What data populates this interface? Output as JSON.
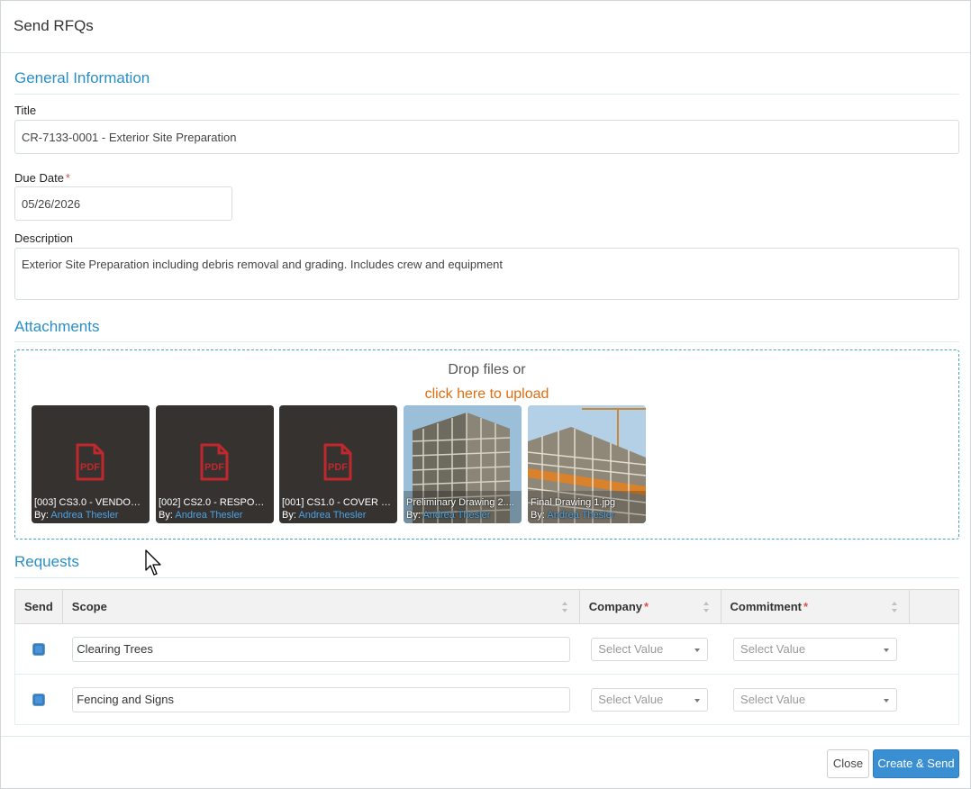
{
  "modal": {
    "title": "Send RFQs"
  },
  "general": {
    "heading": "General Information",
    "title_label": "Title",
    "title_value": "CR-7133-0001 - Exterior Site Preparation",
    "due_label": "Due Date",
    "required_mark": "*",
    "due_value": "05/26/2026",
    "description_label": "Description",
    "description_value": "Exterior Site Preparation including debris removal and grading. Includes crew and equipment"
  },
  "attachments": {
    "heading": "Attachments",
    "drop_text": "Drop files or",
    "upload_link": "click here to upload",
    "by_prefix": "By:",
    "pdf_label": "PDF",
    "files": [
      {
        "name": "[003] CS3.0 - VENDOR...",
        "author": "Andrea Thesler",
        "kind": "pdf"
      },
      {
        "name": "[002] CS2.0 - RESPONS...",
        "author": "Andrea Thesler",
        "kind": "pdf"
      },
      {
        "name": "[001] CS1.0 - COVER SH...",
        "author": "Andrea Thesler",
        "kind": "pdf"
      },
      {
        "name": "Preliminary Drawing 2....",
        "author": "Andrea Thesler",
        "kind": "image"
      },
      {
        "name": "Final Drawing 1.jpg",
        "author": "Andrea Thesler",
        "kind": "image"
      }
    ]
  },
  "requests": {
    "heading": "Requests",
    "columns": {
      "send": "Send",
      "scope": "Scope",
      "company": "Company",
      "commitment": "Commitment"
    },
    "rows": [
      {
        "checked": true,
        "scope": "Clearing Trees",
        "company": "Select Value",
        "commitment": "Select Value"
      },
      {
        "checked": true,
        "scope": "Fencing and Signs",
        "company": "Select Value",
        "commitment": "Select Value"
      }
    ]
  },
  "footer": {
    "close_label": "Close",
    "submit_label": "Create & Send"
  },
  "colors": {
    "accent": "#2a8fc7",
    "upload_link": "#e06d10",
    "required": "#d9534f",
    "primary_button": "#3a8ed2",
    "pdf_icon": "#c0282d"
  },
  "icons": [
    "pdf-icon",
    "sort-icon",
    "caret-down-icon",
    "mouse-cursor-icon",
    "resize-grip-icon"
  ]
}
